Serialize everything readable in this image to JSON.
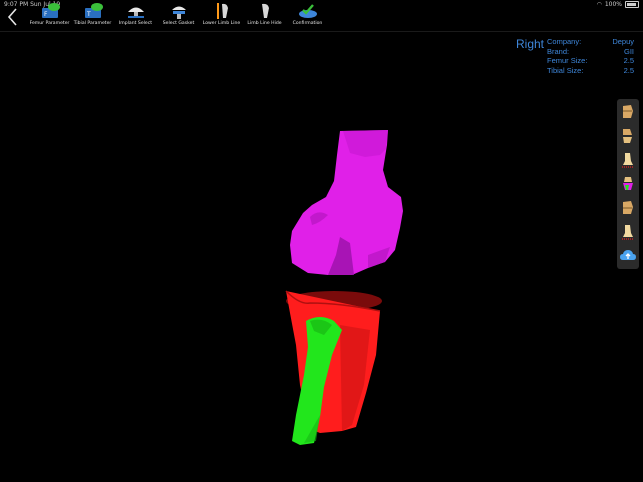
{
  "status": {
    "time": "9:07 PM",
    "date": "Sun Jul 19",
    "battery": "100%"
  },
  "toolbar": {
    "items": [
      {
        "label": "Femur Parameter",
        "icon": "femur-parameter-icon"
      },
      {
        "label": "Tibial Parameter",
        "icon": "tibial-parameter-icon"
      },
      {
        "label": "Implant Select",
        "icon": "implant-select-icon"
      },
      {
        "label": "Select Gasket",
        "icon": "select-gasket-icon"
      },
      {
        "label": "Lower Limb Line",
        "icon": "lower-limb-line-icon"
      },
      {
        "label": "Limb Line Hide",
        "icon": "limb-line-hide-icon"
      },
      {
        "label": "Confirmation",
        "icon": "confirmation-icon"
      }
    ]
  },
  "info": {
    "side": "Right",
    "rows": [
      {
        "label": "Company:",
        "value": "Depuy"
      },
      {
        "label": "Brand:",
        "value": "GII"
      },
      {
        "label": "Femur Size:",
        "value": "2.5"
      },
      {
        "label": "Tibial  Size:",
        "value": "2.5"
      }
    ]
  },
  "side_toolbar": {
    "items": [
      "femur-view-icon",
      "femur-tibia-view-icon",
      "tibia-view-icon",
      "color-model-icon",
      "femur-alt-view-icon",
      "tibia-alt-view-icon",
      "cloud-upload-icon"
    ]
  },
  "colors": {
    "accent": "#3e86d9",
    "femur": "#e020e8",
    "tibia": "#ff1d1d",
    "fibula": "#22e61c",
    "background": "#000000"
  }
}
